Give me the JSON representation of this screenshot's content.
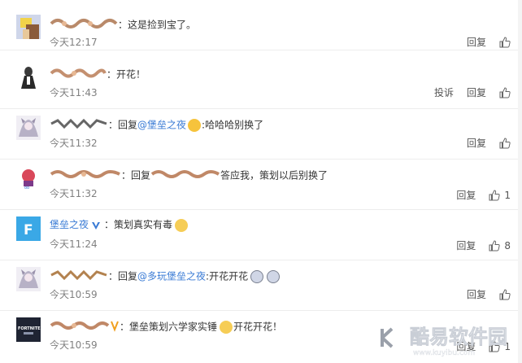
{
  "comments": [
    {
      "separator": "：",
      "prefix": "",
      "target": "",
      "text": "这是捡到宝了。",
      "time": "今天12:17",
      "report": "",
      "reply": "回复",
      "likes": ""
    },
    {
      "separator": "：",
      "prefix": "",
      "target": "",
      "text": "开花！",
      "time": "今天11:43",
      "report": "投诉",
      "reply": "回复",
      "likes": ""
    },
    {
      "separator": "：",
      "prefix": "回复",
      "target": "@堡垒之夜",
      "text": ":哈哈哈别换了",
      "time": "今天11:32",
      "report": "",
      "reply": "回复",
      "likes": ""
    },
    {
      "separator": "：",
      "prefix": "回复",
      "target": "",
      "text": "答应我，策划以后别换了",
      "time": "今天11:32",
      "report": "",
      "reply": "回复",
      "likes": "1"
    },
    {
      "name": "堡垒之夜",
      "separator": "：",
      "prefix": "",
      "target": "",
      "text": "策划真实有毒",
      "time": "今天11:24",
      "report": "",
      "reply": "回复",
      "likes": "8"
    },
    {
      "separator": "：",
      "prefix": "回复",
      "target": "@多玩堡垒之夜",
      "text": ":开花开花",
      "time": "今天10:59",
      "report": "",
      "reply": "回复",
      "likes": ""
    },
    {
      "separator": "：",
      "prefix": "",
      "target": "",
      "text": "堡垒策划六学家实锤",
      "text2": "开花开花！",
      "time": "今天10:59",
      "report": "",
      "reply": "回复",
      "likes": "1"
    }
  ],
  "watermark": {
    "title": "酷易软件园",
    "url": "www.kuyibu.com"
  },
  "colors": {
    "link": "#eb7350",
    "badge": "#3a7bd5",
    "time": "#808080"
  }
}
